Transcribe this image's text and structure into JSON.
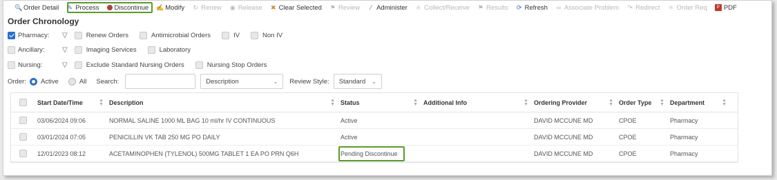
{
  "toolbar": {
    "items": [
      {
        "label": "Order Detail",
        "icon": "magnifier-icon",
        "enabled": true
      },
      {
        "label": "Process",
        "icon": "pencil-icon",
        "enabled": true
      },
      {
        "label": "Discontinue",
        "icon": "stop-icon",
        "enabled": true
      },
      {
        "label": "Modify",
        "icon": "modify-icon",
        "enabled": true
      },
      {
        "label": "Renew",
        "icon": "renew-icon",
        "enabled": false
      },
      {
        "label": "Release",
        "icon": "release-icon",
        "enabled": false
      },
      {
        "label": "Clear Selected",
        "icon": "eraser-icon",
        "enabled": true
      },
      {
        "label": "Review",
        "icon": "review-icon",
        "enabled": false
      },
      {
        "label": "Administer",
        "icon": "syringe-icon",
        "enabled": true
      },
      {
        "label": "Collect/Receive",
        "icon": "collect-icon",
        "enabled": false
      },
      {
        "label": "Results",
        "icon": "results-icon",
        "enabled": false
      },
      {
        "label": "Refresh",
        "icon": "refresh-icon",
        "enabled": true
      },
      {
        "label": "Associate Problem",
        "icon": "associate-icon",
        "enabled": false
      },
      {
        "label": "Redirect",
        "icon": "redirect-icon",
        "enabled": false
      },
      {
        "label": "Order Req",
        "icon": "order-req-icon",
        "enabled": false
      },
      {
        "label": "PDF",
        "icon": "pdf-icon",
        "enabled": true
      }
    ]
  },
  "title": "Order Chronology",
  "filters": {
    "pharmacy": {
      "label": "Pharmacy:",
      "checked": true,
      "options": [
        "Renew Orders",
        "Antimicrobial Orders",
        "IV",
        "Non IV"
      ]
    },
    "ancillary": {
      "label": "Ancillary:",
      "checked": false,
      "options": [
        "Imaging Services",
        "Laboratory"
      ]
    },
    "nursing": {
      "label": "Nursing:",
      "checked": false,
      "options": [
        "Exclude Standard Nursing Orders",
        "Nursing Stop Orders"
      ]
    }
  },
  "order_bar": {
    "orders_label": "Order:",
    "active_label": "Active",
    "all_label": "All",
    "search_label": "Search:",
    "search_value": "",
    "search_by": "Description",
    "review_style_label": "Review Style:",
    "review_style": "Standard"
  },
  "table": {
    "columns": [
      "Start Date/Time",
      "Description",
      "Status",
      "Additional Info",
      "Ordering Provider",
      "Order Type",
      "Department"
    ],
    "rows": [
      {
        "start": "03/06/2024 09:06",
        "description": "NORMAL SALINE 1000 ML BAG 10 ml/hr IV CONTINUOUS",
        "status": "Active",
        "additional": "",
        "provider": "DAVID MCCUNE MD",
        "type": "CPOE",
        "department": "Pharmacy"
      },
      {
        "start": "03/01/2024 07:05",
        "description": "PENICILLIN VK TAB 250 MG PO DAILY",
        "status": "Active",
        "additional": "",
        "provider": "DAVID MCCUNE MD",
        "type": "CPOE",
        "department": "Pharmacy"
      },
      {
        "start": "12/01/2023 08:12",
        "description": "ACETAMINOPHEN (TYLENOL) 500MG TABLET 1 EA PO PRN Q6H",
        "status": "Pending Discontinue",
        "additional": "",
        "provider": "DAVID MCCUNE MD",
        "type": "CPOE",
        "department": "Pharmacy"
      }
    ]
  },
  "colors": {
    "accent": "#2a6fd1",
    "highlight": "#5a9a2a",
    "stop": "#a84040"
  }
}
